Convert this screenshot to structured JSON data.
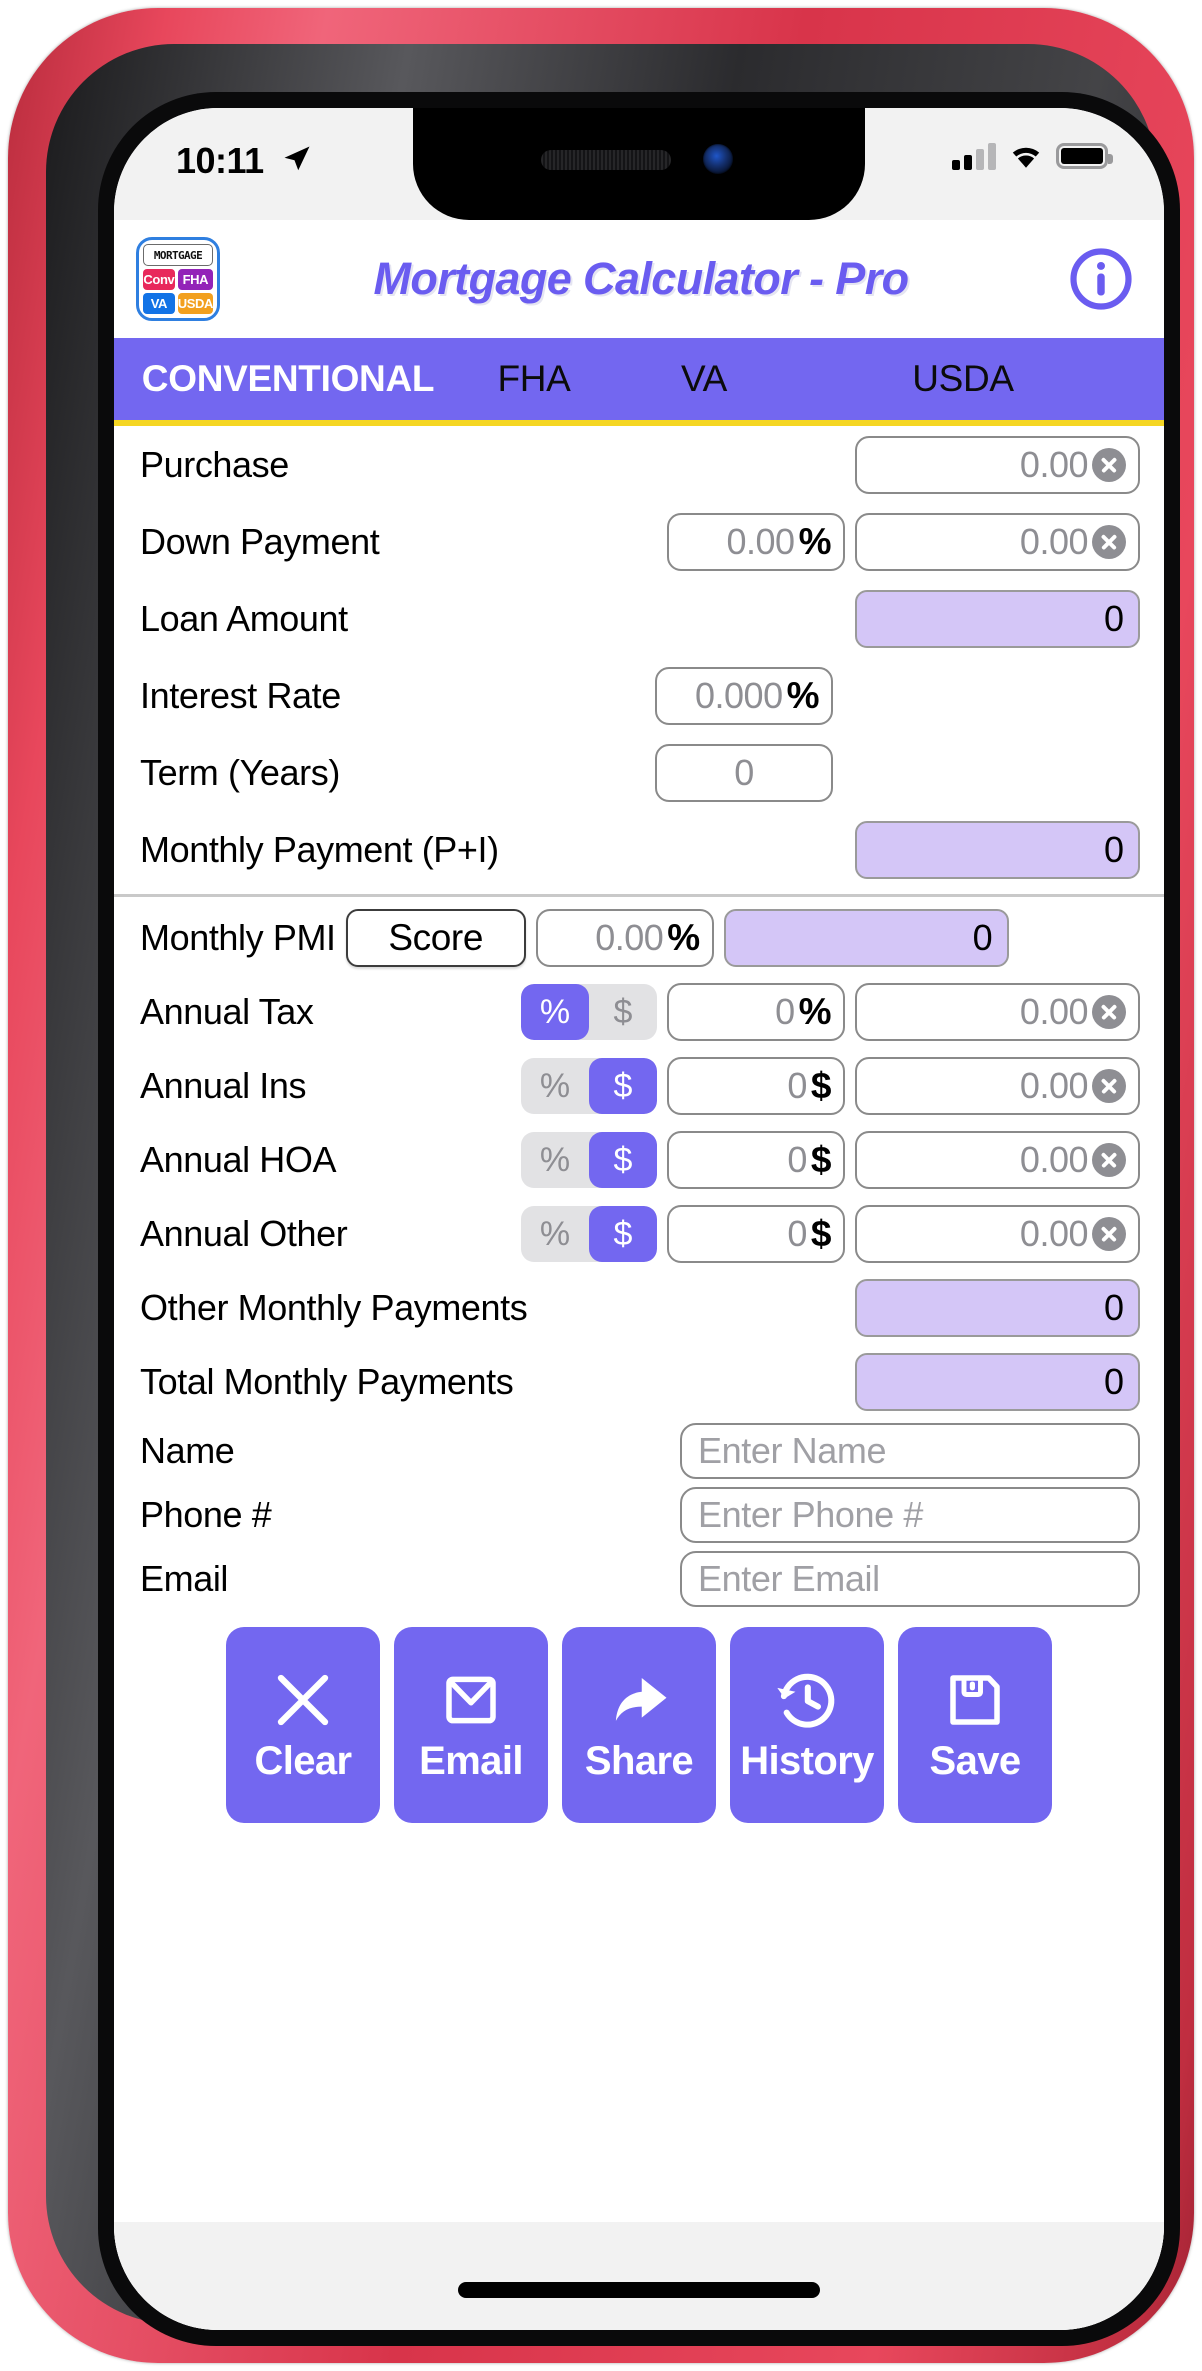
{
  "status_bar": {
    "time": "10:11",
    "location_icon": "location-arrow-icon",
    "signal_icon": "cellular-signal-icon",
    "wifi_icon": "wifi-icon",
    "battery_icon": "battery-icon"
  },
  "header": {
    "title": "Mortgage Calculator - Pro",
    "info_icon": "info-circle-icon",
    "app_icon": {
      "top_label": "MORTGAGE",
      "cells": [
        "Conv",
        "FHA",
        "VA",
        "USDA"
      ],
      "colors": [
        "#e8285c",
        "#9323b8",
        "#1273e6",
        "#f2a01e"
      ]
    }
  },
  "tabs": {
    "items": [
      {
        "label": "CONVENTIONAL",
        "selected": true
      },
      {
        "label": "FHA",
        "selected": false
      },
      {
        "label": "VA",
        "selected": false
      },
      {
        "label": "USDA",
        "selected": false
      }
    ],
    "bar_color": "#7367f0",
    "underline_color": "#f5d623",
    "selected_text_color": "#ffffff",
    "unselected_text_color": "#0b0b0b"
  },
  "form": {
    "purchase": {
      "label": "Purchase",
      "amount_value": "0.00",
      "has_clear": true
    },
    "down_payment": {
      "label": "Down Payment",
      "percent_value": "0.00",
      "percent_unit": "%",
      "amount_value": "0.00",
      "has_clear": true
    },
    "loan_amount": {
      "label": "Loan Amount",
      "result_value": "0"
    },
    "interest_rate": {
      "label": "Interest Rate",
      "percent_value": "0.000",
      "percent_unit": "%"
    },
    "term_years": {
      "label": "Term (Years)",
      "value": "0"
    },
    "monthly_payment": {
      "label": "Monthly Payment (P+I)",
      "result_value": "0"
    },
    "monthly_pmi": {
      "label": "Monthly PMI",
      "score_label": "Score",
      "percent_value": "0.00",
      "percent_unit": "%",
      "result_value": "0"
    },
    "annual_tax": {
      "label": "Annual Tax",
      "toggle": {
        "percent": "%",
        "dollar": "$",
        "selected": "percent"
      },
      "input_value": "0",
      "input_unit": "%",
      "amount_value": "0.00",
      "has_clear": true
    },
    "annual_ins": {
      "label": "Annual Ins",
      "toggle": {
        "percent": "%",
        "dollar": "$",
        "selected": "dollar"
      },
      "input_value": "0",
      "input_unit": "$",
      "amount_value": "0.00",
      "has_clear": true
    },
    "annual_hoa": {
      "label": "Annual HOA",
      "toggle": {
        "percent": "%",
        "dollar": "$",
        "selected": "dollar"
      },
      "input_value": "0",
      "input_unit": "$",
      "amount_value": "0.00",
      "has_clear": true
    },
    "annual_other": {
      "label": "Annual Other",
      "toggle": {
        "percent": "%",
        "dollar": "$",
        "selected": "dollar"
      },
      "input_value": "0",
      "input_unit": "$",
      "amount_value": "0.00",
      "has_clear": true
    },
    "other_monthly": {
      "label": "Other Monthly Payments",
      "result_value": "0"
    },
    "total_monthly": {
      "label": "Total Monthly Payments",
      "result_value": "0"
    },
    "name": {
      "label": "Name",
      "placeholder": "Enter Name",
      "value": ""
    },
    "phone": {
      "label": "Phone #",
      "placeholder": "Enter Phone #",
      "value": ""
    },
    "email": {
      "label": "Email",
      "placeholder": "Enter Email",
      "value": ""
    }
  },
  "actions": [
    {
      "label": "Clear",
      "icon": "close-x-icon"
    },
    {
      "label": "Email",
      "icon": "envelope-icon"
    },
    {
      "label": "Share",
      "icon": "share-arrow-icon"
    },
    {
      "label": "History",
      "icon": "clock-history-icon"
    },
    {
      "label": "Save",
      "icon": "floppy-disk-icon"
    }
  ],
  "theme": {
    "accent": "#7367f0",
    "result_field": "#d4c6f7",
    "title_color": "#6a5cf0",
    "case_color": "#d8344a"
  }
}
